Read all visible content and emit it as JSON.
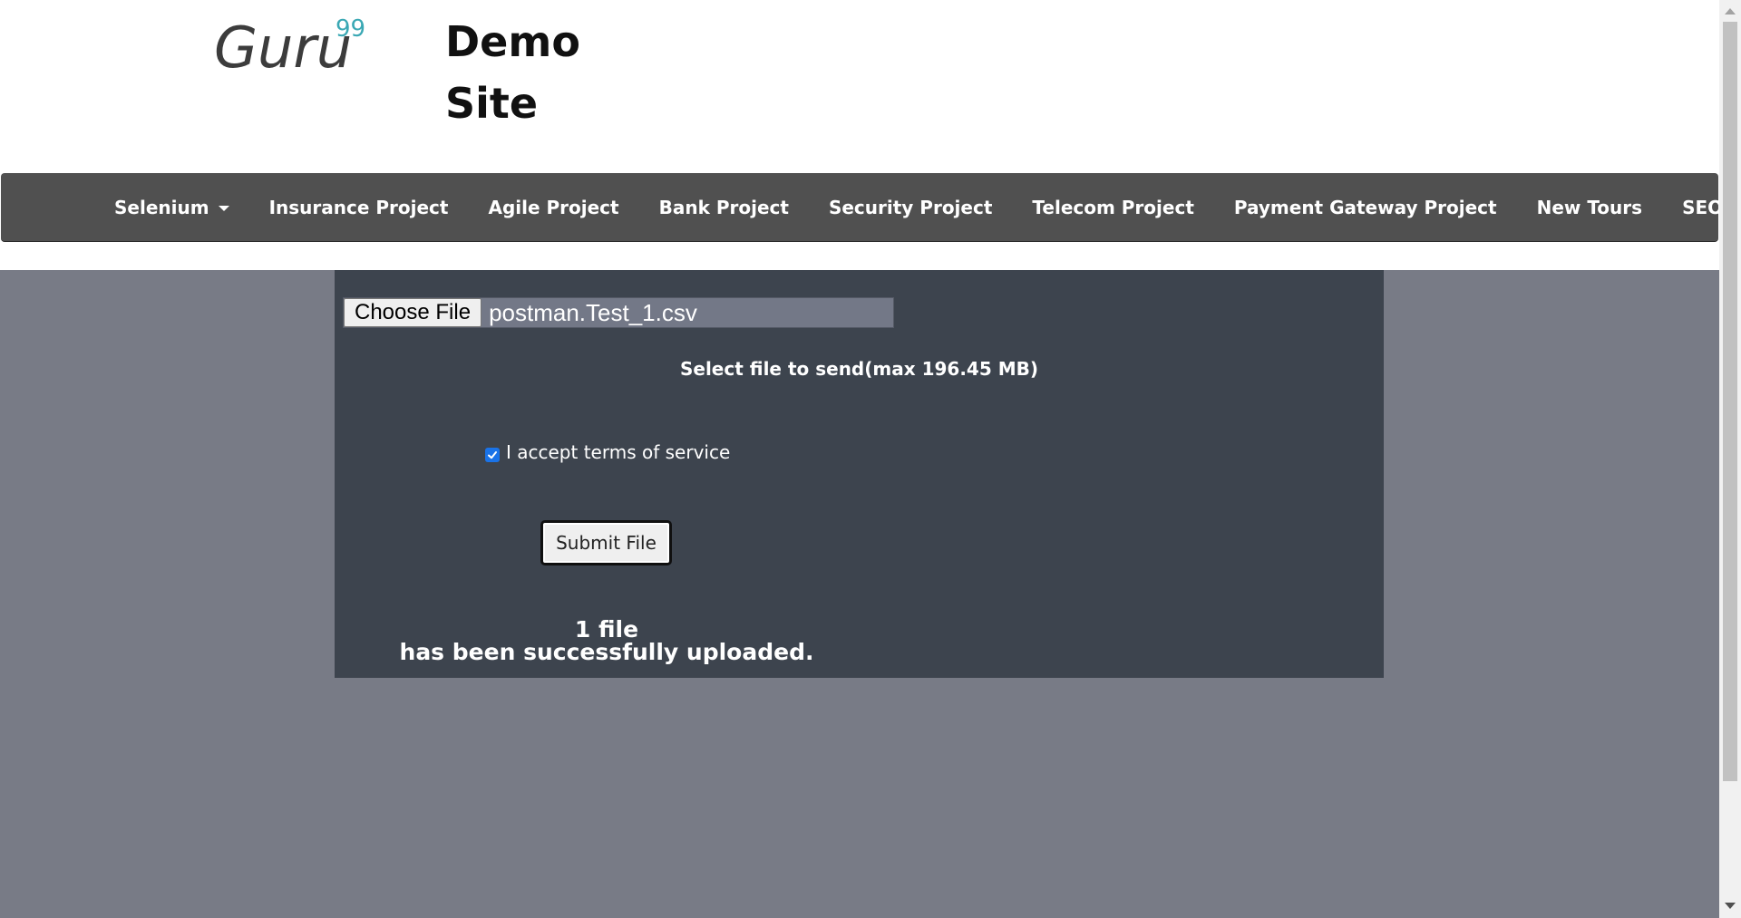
{
  "header": {
    "logo_text": "Guru",
    "logo_superscript": "99",
    "title_line1": "Demo",
    "title_line2": "Site"
  },
  "nav": {
    "items": [
      {
        "label": "Selenium",
        "dropdown": true
      },
      {
        "label": "Insurance Project",
        "dropdown": false
      },
      {
        "label": "Agile Project",
        "dropdown": false
      },
      {
        "label": "Bank Project",
        "dropdown": false
      },
      {
        "label": "Security Project",
        "dropdown": false
      },
      {
        "label": "Telecom Project",
        "dropdown": false
      },
      {
        "label": "Payment Gateway Project",
        "dropdown": false
      },
      {
        "label": "New Tours",
        "dropdown": false
      },
      {
        "label": "SEO",
        "dropdown": true
      }
    ]
  },
  "upload": {
    "choose_file_label": "Choose File",
    "selected_file": "postman.Test_1.csv",
    "hint": "Select file to send(max 196.45 MB)",
    "terms_label": "I accept terms of service",
    "terms_checked": true,
    "submit_label": "Submit File",
    "result_line1": "1 file",
    "result_line2": "has been successfully uploaded."
  },
  "colors": {
    "navbar": "#505050",
    "panel": "#3d444e",
    "page_background": "#787b86",
    "logo_accent": "#3aa8b4",
    "checkbox": "#1a73e8"
  }
}
